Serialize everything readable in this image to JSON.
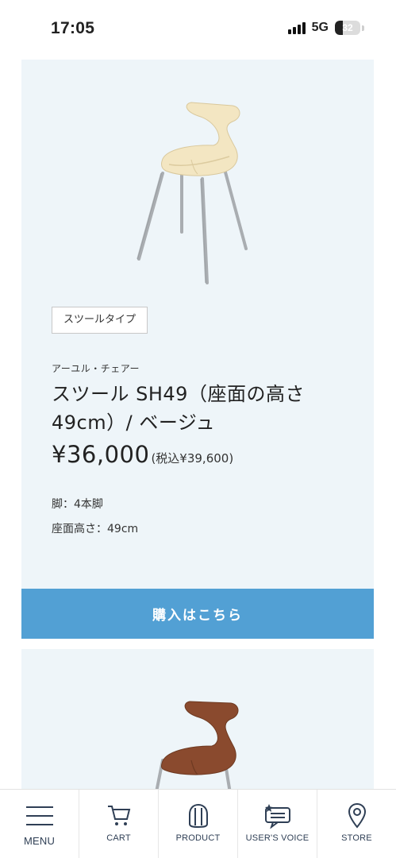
{
  "status": {
    "time": "17:05",
    "network": "5G",
    "battery": "32",
    "battery_level": 0.32
  },
  "product1": {
    "category_tag": "スツールタイプ",
    "brand": "アーユル・チェアー",
    "title": "スツール SH49（座面の高さ49cm）/ ベージュ",
    "price": "¥36,000",
    "price_tax": "(税込¥39,600)",
    "specs": [
      "脚：4本脚",
      "座面高さ：49cm"
    ],
    "seat_color": "#f3e6c2",
    "buy_label": "購入はこちら"
  },
  "product2": {
    "seat_color": "#8a4a2e"
  },
  "nav": [
    {
      "label": "MENU",
      "icon": "menu-icon"
    },
    {
      "label": "CART",
      "icon": "cart-icon"
    },
    {
      "label": "PRODUCT",
      "icon": "chair-icon"
    },
    {
      "label": "USER'S VOICE",
      "icon": "chat-icon"
    },
    {
      "label": "STORE",
      "icon": "location-pin-icon"
    }
  ],
  "colors": {
    "accent": "#52a0d4",
    "card_bg": "#eef5f9"
  }
}
